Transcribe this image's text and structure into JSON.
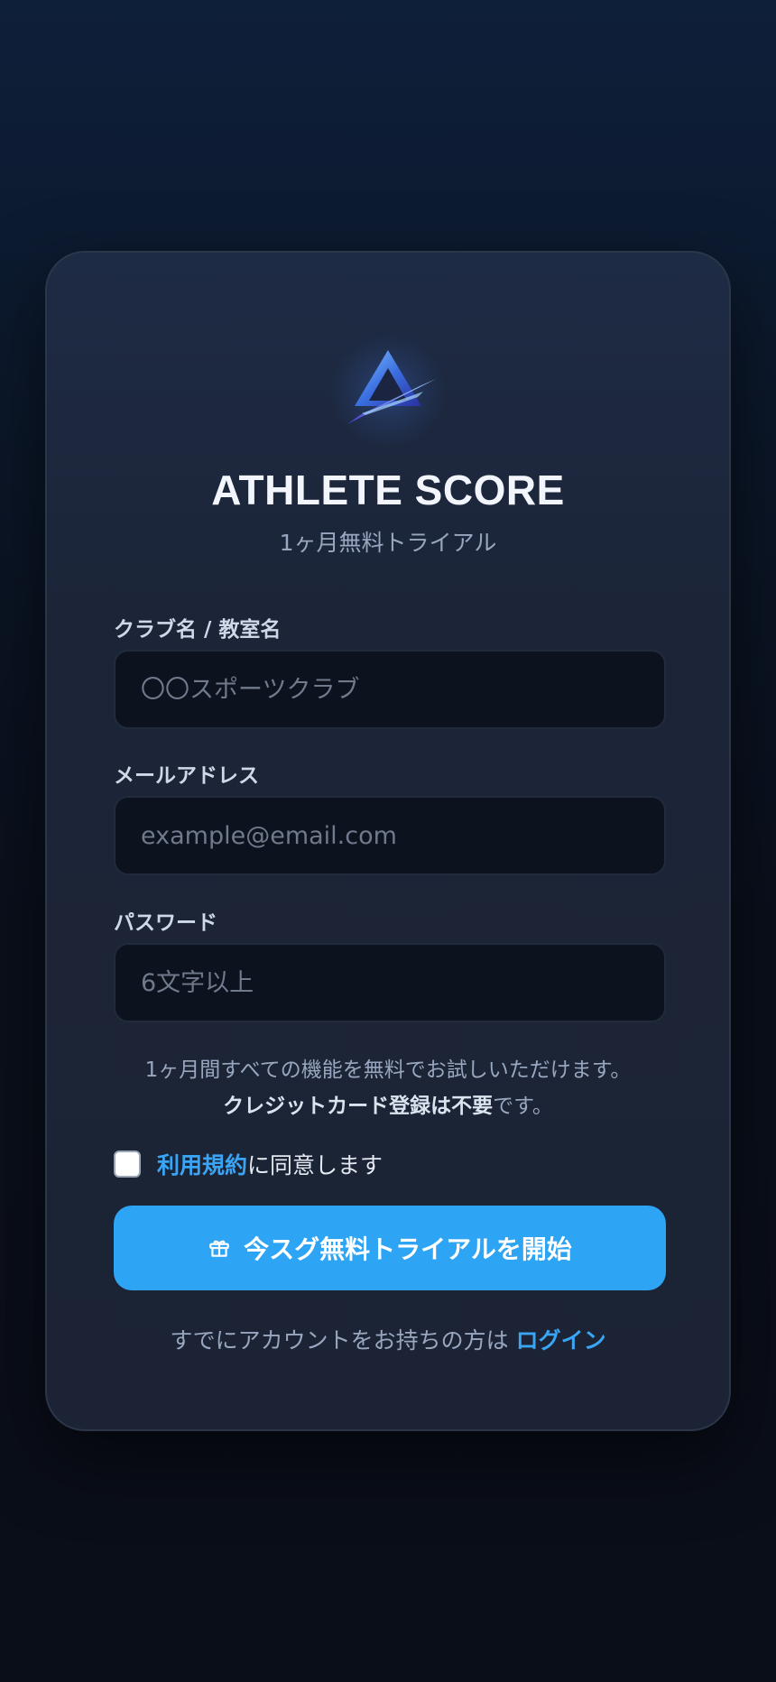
{
  "app": {
    "title": "ATHLETE SCORE",
    "subtitle": "1ヶ月無料トライアル",
    "logo_icon": "triangle-logo-icon"
  },
  "form": {
    "club": {
      "label": "クラブ名 / 教室名",
      "placeholder": "〇〇スポーツクラブ",
      "value": ""
    },
    "email": {
      "label": "メールアドレス",
      "placeholder": "example@email.com",
      "value": ""
    },
    "password": {
      "label": "パスワード",
      "placeholder": "6文字以上",
      "value": ""
    }
  },
  "notice": {
    "line1": "1ヶ月間すべての機能を無料でお試しいただけます。",
    "line2_bold": "クレジットカード登録は不要",
    "line2_rest": "です。"
  },
  "terms": {
    "checked": false,
    "link_label": "利用規約",
    "suffix": "に同意します"
  },
  "cta": {
    "icon": "gift-icon",
    "label": "今スグ無料トライアルを開始"
  },
  "footer": {
    "prompt": "すでにアカウントをお持ちの方は",
    "login_label": "ログイン"
  },
  "colors": {
    "accent": "#2ea4f5",
    "link": "#3aa5f5",
    "card_bg": "#1c2538",
    "page_bg": "#0a0f1b"
  }
}
